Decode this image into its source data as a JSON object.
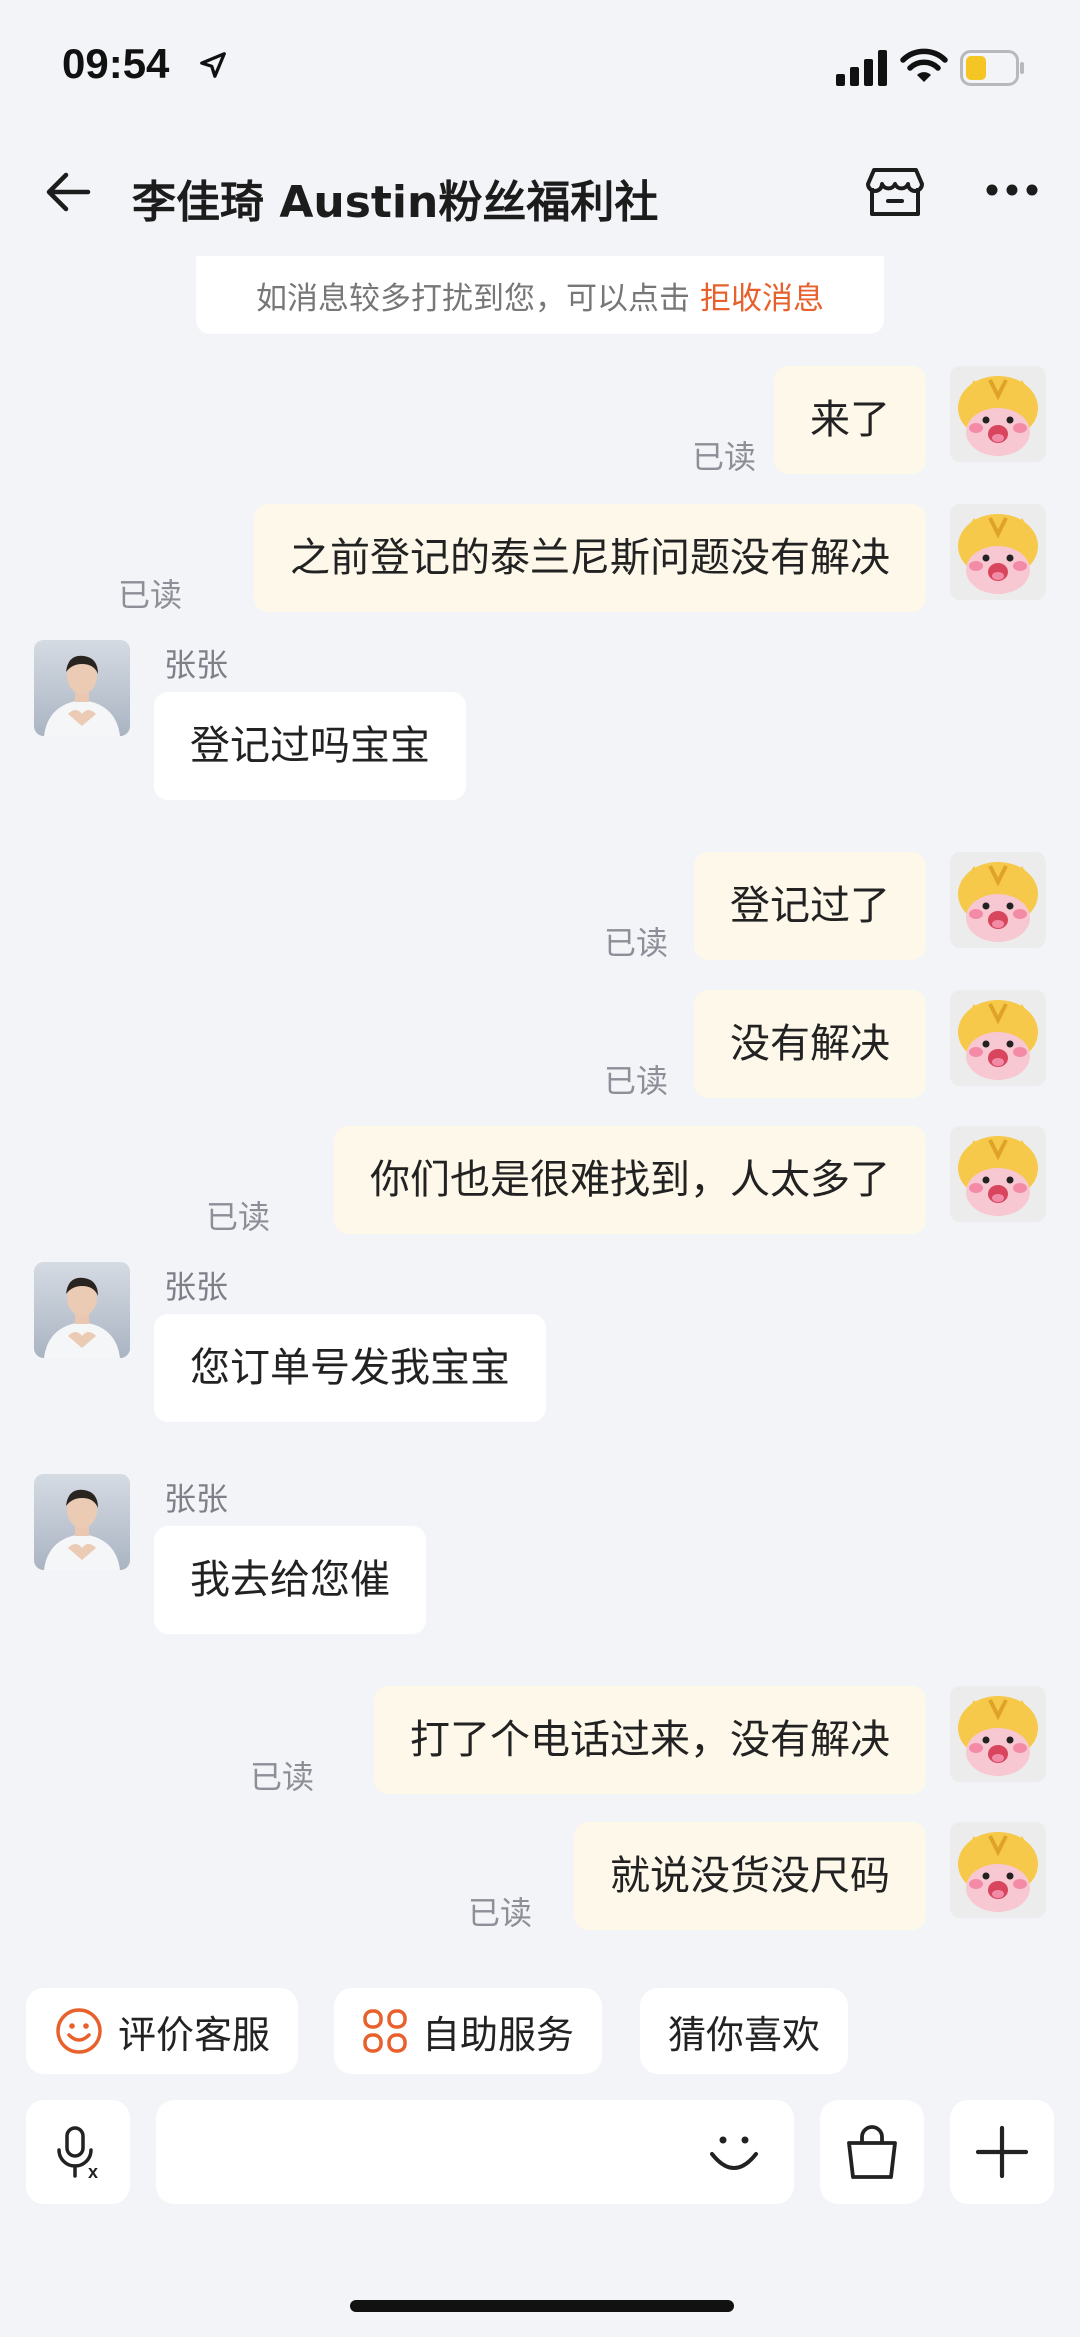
{
  "status_bar": {
    "time": "09:54"
  },
  "nav": {
    "title": "李佳琦 Austin粉丝福利社"
  },
  "notice": {
    "text": "如消息较多打扰到您，可以点击",
    "link": "拒收消息"
  },
  "messages": [
    {
      "dir": "out",
      "text": "来了",
      "status": "已读"
    },
    {
      "dir": "out",
      "text": "之前登记的泰兰尼斯问题没有解决",
      "status": "已读"
    },
    {
      "dir": "in",
      "sender": "张张",
      "text": "登记过吗宝宝"
    },
    {
      "dir": "out",
      "text": "登记过了",
      "status": "已读"
    },
    {
      "dir": "out",
      "text": "没有解决",
      "status": "已读"
    },
    {
      "dir": "out",
      "text": "你们也是很难找到，人太多了",
      "status": "已读"
    },
    {
      "dir": "in",
      "sender": "张张",
      "text": "您订单号发我宝宝"
    },
    {
      "dir": "in",
      "sender": "张张",
      "text": "我去给您催"
    },
    {
      "dir": "out",
      "text": "打了个电话过来，没有解决",
      "status": "已读"
    },
    {
      "dir": "out",
      "text": "就说没货没尺码",
      "status": "已读"
    }
  ],
  "quick_actions": [
    {
      "label": "评价客服",
      "icon": "smiley-icon"
    },
    {
      "label": "自助服务",
      "icon": "grid-flower-icon"
    },
    {
      "label": "猜你喜欢"
    }
  ],
  "colors": {
    "accent": "#e8612c",
    "outgoing_bubble": "#fdf8ea",
    "background": "#f3f4f7"
  }
}
